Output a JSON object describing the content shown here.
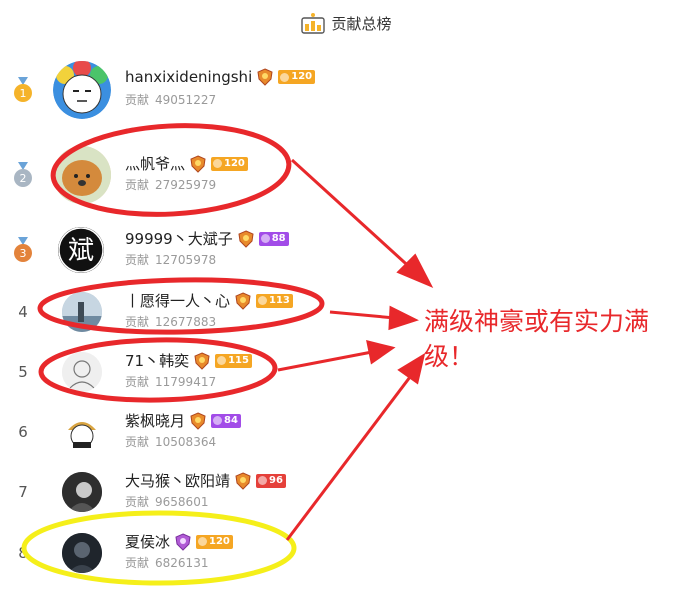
{
  "header": {
    "title": "贡献总榜",
    "icon": "podium-icon"
  },
  "contrib_label": "贡献",
  "rows": [
    {
      "rank": "1",
      "medal": "gold",
      "name": "hanxixideningshi",
      "level": "120",
      "level_style": "orange",
      "score": "49051227",
      "avatar_bg": "#f1e7a8"
    },
    {
      "rank": "2",
      "medal": "silver",
      "name": "灬帆爷灬",
      "level": "120",
      "level_style": "orange",
      "score": "27925979",
      "avatar_bg": "#e8c9a0"
    },
    {
      "rank": "3",
      "medal": "bronze",
      "name": "99999丶大斌子",
      "level": "88",
      "level_style": "purple",
      "score": "12705978",
      "avatar_bg": "#111111",
      "avatar_text": "斌"
    },
    {
      "rank": "4",
      "medal": "",
      "name": "丨愿得一人丶心",
      "level": "113",
      "level_style": "orange",
      "score": "12677883",
      "avatar_bg": "#9fb6c6"
    },
    {
      "rank": "5",
      "medal": "",
      "name": "71丶韩奕",
      "level": "115",
      "level_style": "orange",
      "score": "11799417",
      "avatar_bg": "#e9e9e9"
    },
    {
      "rank": "6",
      "medal": "",
      "name": "紫枫晓月",
      "level": "84",
      "level_style": "purple",
      "score": "10508364",
      "avatar_bg": "#d9a441"
    },
    {
      "rank": "7",
      "medal": "",
      "name": "大马猴丶欧阳靖",
      "level": "96",
      "level_style": "red",
      "score": "9658601",
      "avatar_bg": "#3a3a3a"
    },
    {
      "rank": "8",
      "medal": "",
      "name": "夏侯冰",
      "level": "120",
      "level_style": "orange",
      "score": "6826131",
      "avatar_bg": "#2a3038"
    }
  ],
  "annotation": {
    "text": "满级神豪或有实力满级！",
    "color": "#e8282b",
    "highlight_yellow": "#f5ef1a"
  },
  "colors": {
    "level_orange": "#f5a623",
    "level_purple": "#a24ce8",
    "level_red": "#e5403a",
    "gold": "#f5b32a",
    "silver": "#a9b6c3",
    "bronze": "#e3833b"
  }
}
